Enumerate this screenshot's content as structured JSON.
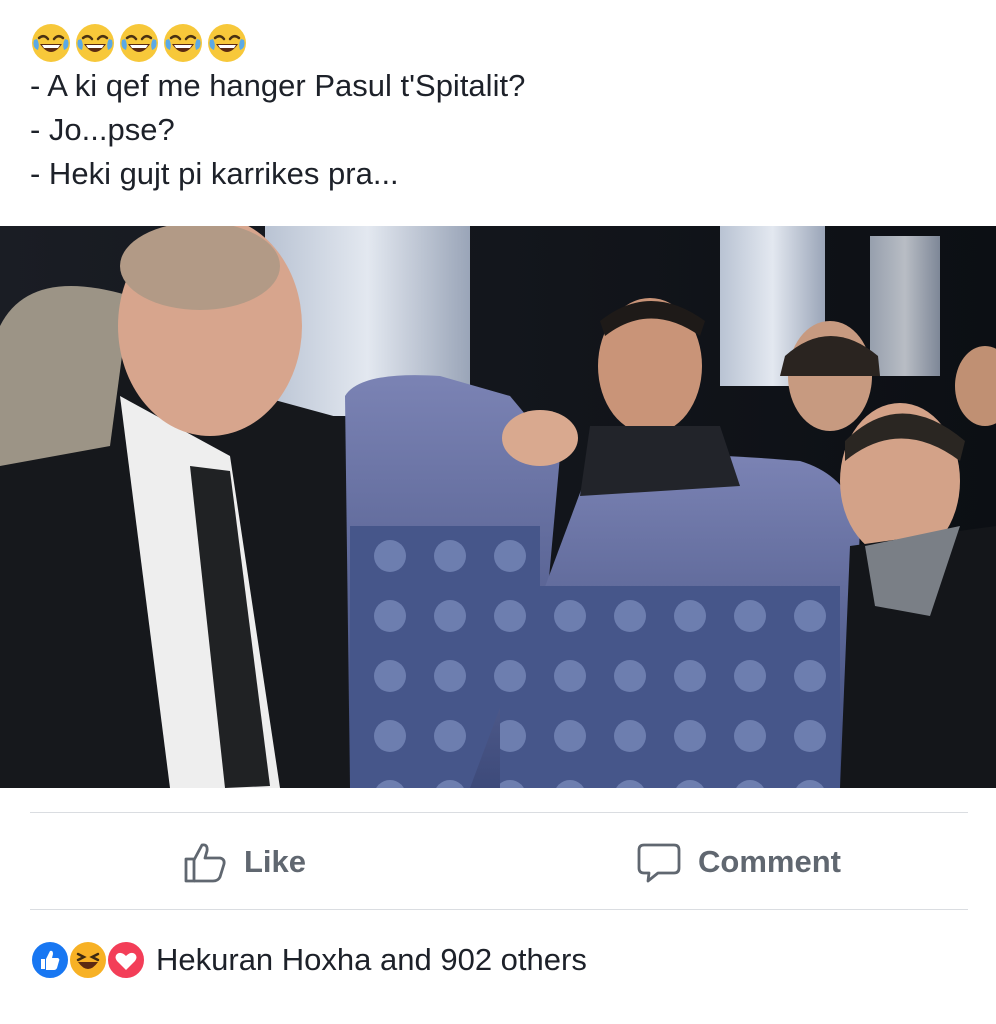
{
  "post": {
    "emoji": [
      "face-with-tears-of-joy",
      "face-with-tears-of-joy",
      "face-with-tears-of-joy",
      "face-with-tears-of-joy",
      "face-with-tears-of-joy"
    ],
    "lines": [
      "- A ki qef me hanger Pasul t'Spitalit?",
      "- Jo...pse?",
      "- Heki gujt pi karrikes pra..."
    ]
  },
  "photo": {
    "icon": "photo-bus-seats"
  },
  "actions": {
    "like_label": "Like",
    "comment_label": "Comment"
  },
  "reactions": {
    "icons": [
      "like-reaction-icon",
      "haha-reaction-icon",
      "love-reaction-icon"
    ],
    "summary": "Hekuran Hoxha and 902 others"
  },
  "colors": {
    "text": "#1d2129",
    "action_gray": "#606770",
    "divider": "#dadde1",
    "like_blue": "#1877f2",
    "love_red": "#f33e58",
    "haha_yellow": "#f7b125"
  }
}
